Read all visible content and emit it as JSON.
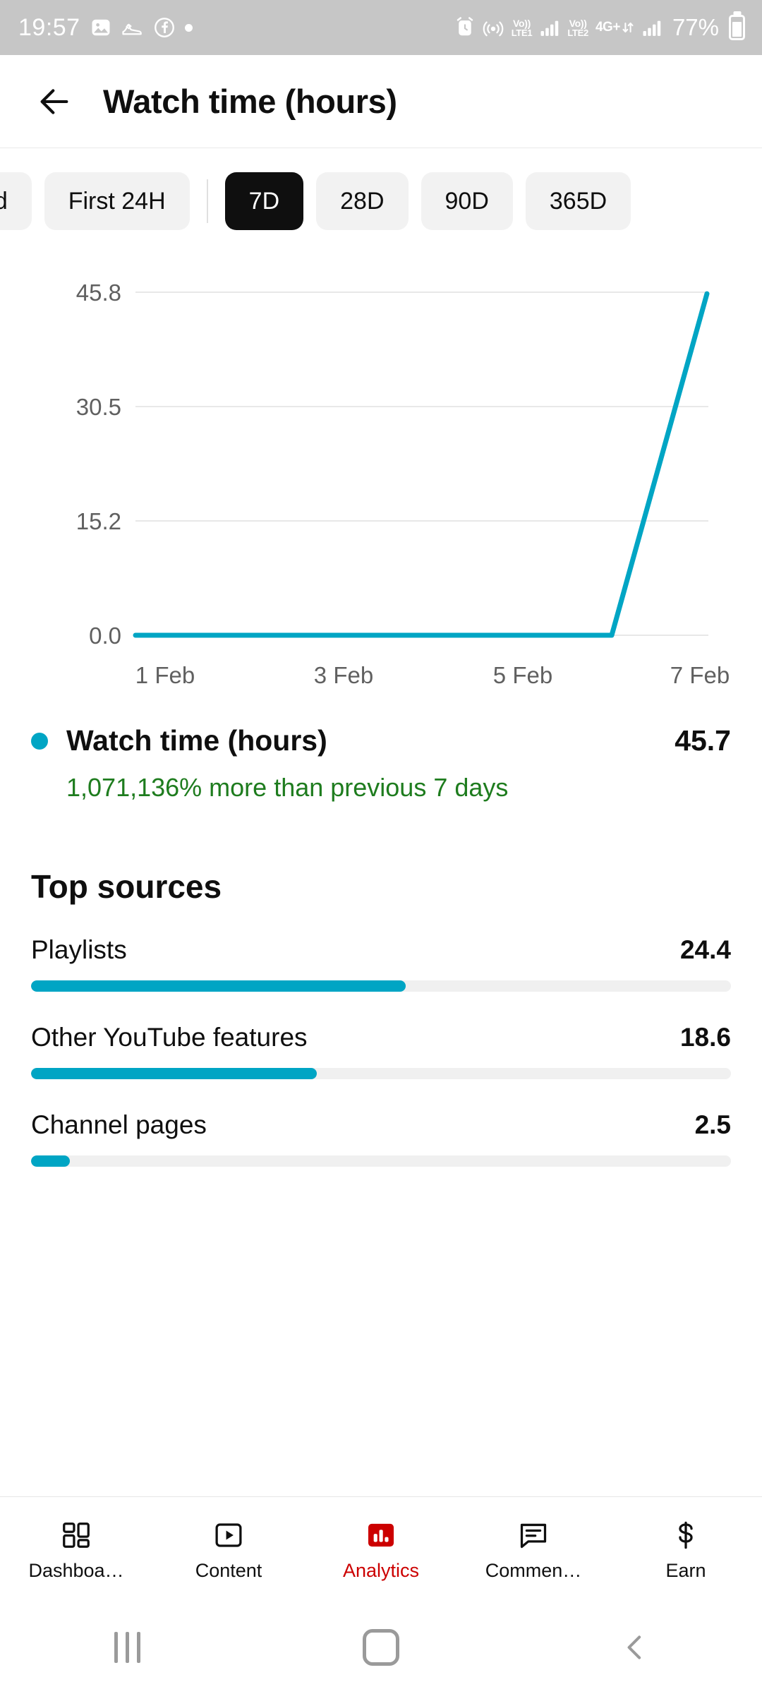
{
  "statusbar": {
    "time": "19:57",
    "left_icons": [
      "photos-icon",
      "shoe-icon",
      "facebook-icon",
      "dot-indicator-icon"
    ],
    "alarm_icon": "alarm-icon",
    "hotspot_icon": "hotspot-icon",
    "sim1_volte_top": "Vo))",
    "sim1_volte_bottom": "LTE1",
    "sim2_volte_top": "Vo))",
    "sim2_volte_bottom": "LTE2",
    "network_label": "4G+",
    "battery_percent": "77%"
  },
  "appbar": {
    "back_icon": "back-arrow-icon",
    "title": "Watch time (hours)"
  },
  "chips": [
    {
      "label": "hed",
      "selected": false
    },
    {
      "label": "First 24H",
      "selected": false
    },
    {
      "label": "7D",
      "selected": true
    },
    {
      "label": "28D",
      "selected": false
    },
    {
      "label": "90D",
      "selected": false
    },
    {
      "label": "365D",
      "selected": false
    }
  ],
  "chart_data": {
    "type": "line",
    "title": "Watch time (hours)",
    "xlabel": "",
    "ylabel": "",
    "grid": true,
    "legend_position": "below",
    "accent_color": "#00a5c4",
    "x": [
      "1 Feb",
      "2 Feb",
      "3 Feb",
      "4 Feb",
      "5 Feb",
      "6 Feb",
      "7 Feb"
    ],
    "xtick_labels": [
      "1 Feb",
      "3 Feb",
      "5 Feb",
      "7 Feb"
    ],
    "ytick_labels": [
      "45.8",
      "30.5",
      "15.2",
      "0.0"
    ],
    "ylim": [
      0.0,
      45.8
    ],
    "series": [
      {
        "name": "Watch time (hours)",
        "color": "#00a5c4",
        "values": [
          0.0,
          0.0,
          0.0,
          0.0,
          0.0,
          0.0,
          45.7
        ]
      }
    ]
  },
  "metric": {
    "legend_dot": "series-color-dot",
    "name": "Watch time (hours)",
    "value": "45.7",
    "delta_text": "1,071,136% more than previous 7 days",
    "delta_color": "#1e7c1e"
  },
  "top_sources": {
    "title": "Top sources",
    "items": [
      {
        "label": "Playlists",
        "value": "24.4",
        "percent": 53.5
      },
      {
        "label": "Other YouTube features",
        "value": "18.6",
        "percent": 40.8
      },
      {
        "label": "Channel pages",
        "value": "2.5",
        "percent": 5.5
      }
    ]
  },
  "bottom_nav": {
    "active_color": "#cc0000",
    "items": [
      {
        "label": "Dashboa…",
        "icon": "dashboard-icon",
        "active": false
      },
      {
        "label": "Content",
        "icon": "content-video-icon",
        "active": false
      },
      {
        "label": "Analytics",
        "icon": "analytics-bar-icon",
        "active": true
      },
      {
        "label": "Commen…",
        "icon": "comments-icon",
        "active": false
      },
      {
        "label": "Earn",
        "icon": "earn-dollar-icon",
        "active": false
      }
    ]
  },
  "android_nav": {
    "recents": "recents-icon",
    "home": "home-icon",
    "back": "back-icon"
  }
}
